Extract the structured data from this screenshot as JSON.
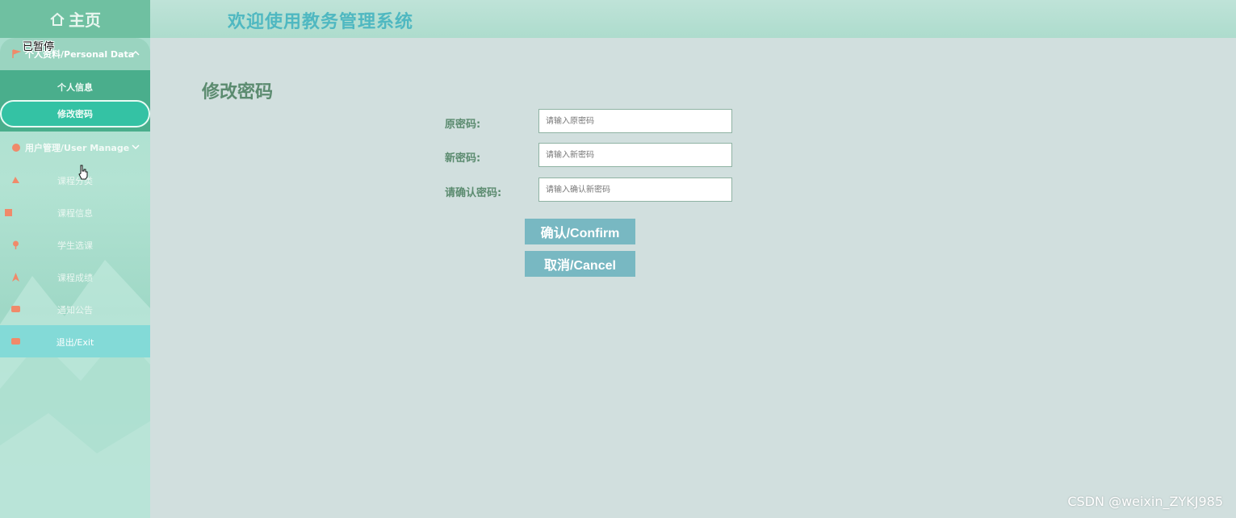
{
  "sidebar": {
    "home_label": "主页",
    "paused_overlay": "已暂停",
    "personal_menu": {
      "label": "个人资料/Personal Data",
      "items": [
        {
          "label": "个人信息"
        },
        {
          "label": "修改密码"
        }
      ]
    },
    "user_menu": {
      "label": "用户管理/User Manage"
    },
    "nav_items": [
      {
        "label": "课程分类"
      },
      {
        "label": "课程信息"
      },
      {
        "label": "学生选课"
      },
      {
        "label": "课程成绩"
      },
      {
        "label": "通知公告"
      },
      {
        "label": "退出/Exit"
      }
    ]
  },
  "header": {
    "title": "欢迎使用教务管理系统"
  },
  "form": {
    "title": "修改密码",
    "fields": [
      {
        "label": "原密码:",
        "placeholder": "请输入原密码",
        "value": ""
      },
      {
        "label": "新密码:",
        "placeholder": "请输入新密码",
        "value": ""
      },
      {
        "label": "请确认密码:",
        "placeholder": "请输入确认新密码",
        "value": ""
      }
    ],
    "confirm_label": "确认/Confirm",
    "cancel_label": "取消/Cancel"
  },
  "watermark": "CSDN @weixin_ZYKJ985",
  "colors": {
    "accent": "#4fb8c1",
    "sidebar_active": "#34c2a4",
    "button": "#78b8c2",
    "label": "#5b8b6f",
    "icon": "#f08a6a"
  }
}
